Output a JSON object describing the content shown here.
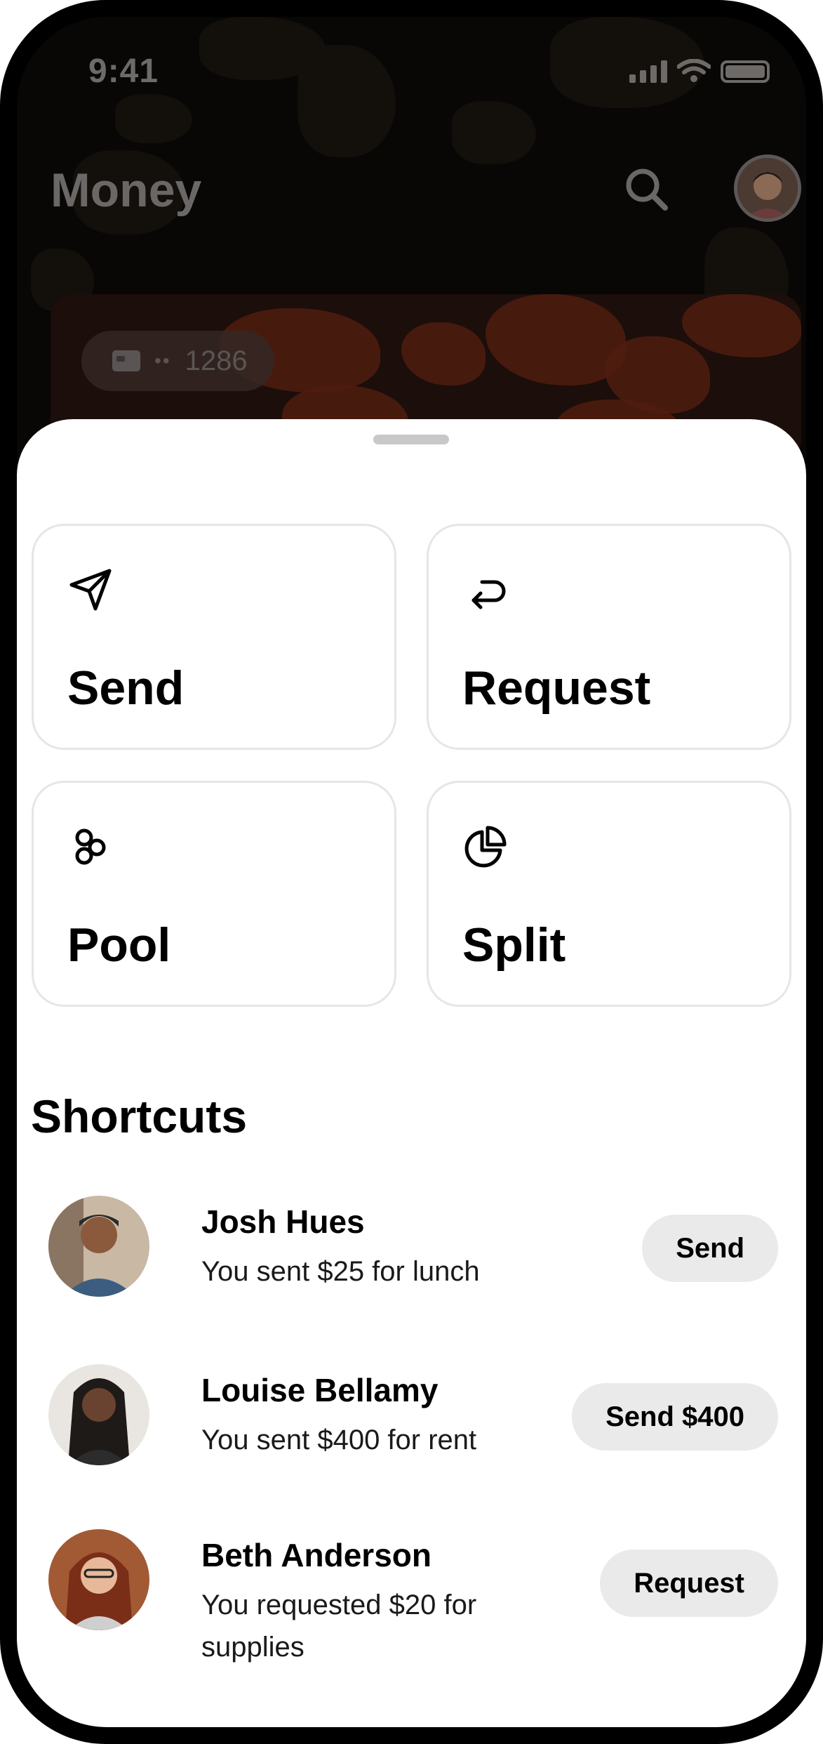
{
  "status": {
    "time": "9:41"
  },
  "header": {
    "title": "Money"
  },
  "card": {
    "dots": "••",
    "last4": "1286"
  },
  "actions": [
    {
      "label": "Send",
      "icon": "send-icon"
    },
    {
      "label": "Request",
      "icon": "return-arrow-icon"
    },
    {
      "label": "Pool",
      "icon": "pool-icon"
    },
    {
      "label": "Split",
      "icon": "pie-chart-icon"
    }
  ],
  "shortcuts": {
    "title": "Shortcuts",
    "items": [
      {
        "name": "Josh Hues",
        "subtitle": "You sent $25 for lunch",
        "button": "Send"
      },
      {
        "name": "Louise Bellamy",
        "subtitle": "You sent $400 for rent",
        "button": "Send $400"
      },
      {
        "name": "Beth Anderson",
        "subtitle": "You requested $20 for supplies",
        "button": "Request"
      }
    ]
  }
}
